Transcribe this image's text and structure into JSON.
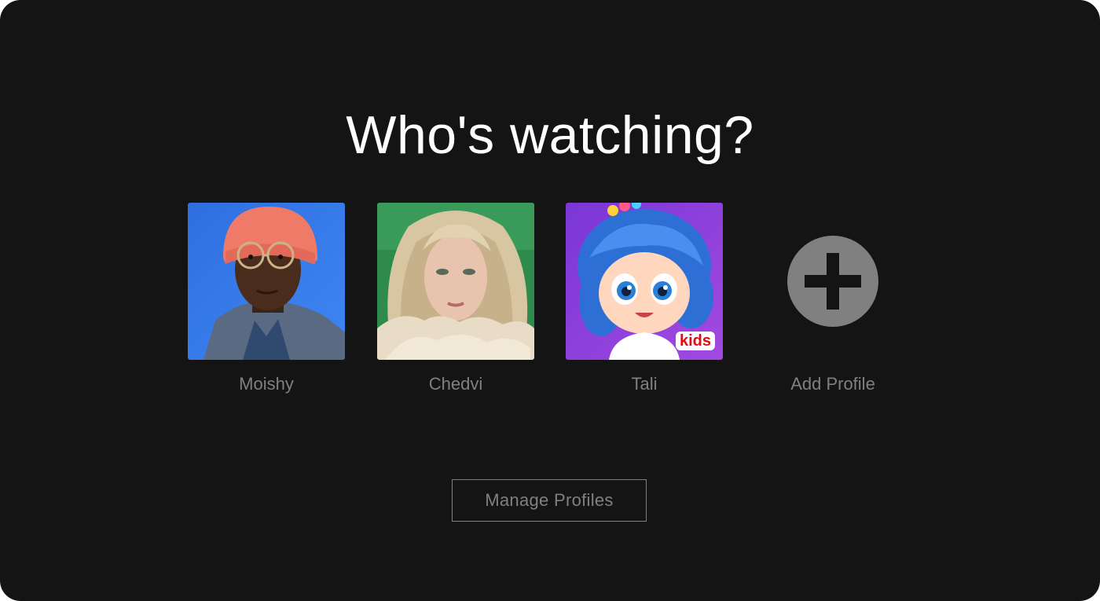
{
  "page": {
    "title": "Who's watching?",
    "background_color": "#141414"
  },
  "profiles": [
    {
      "name": "Moishy",
      "avatar": "man-orange-beanie-glasses-photo",
      "background_color": "#2f6fe0"
    },
    {
      "name": "Chedvi",
      "avatar": "woman-blonde-hair-fur-photo",
      "background_color": "#2f8a4e"
    },
    {
      "name": "Tali",
      "avatar": "cartoon-girl-blue-hair",
      "background_color": "#8a3fd8",
      "badge": "kids"
    }
  ],
  "add_profile": {
    "label": "Add Profile",
    "icon": "plus-icon",
    "color": "#808080"
  },
  "manage_button": {
    "label": "Manage Profiles"
  },
  "colors": {
    "text_primary": "#ffffff",
    "text_secondary": "#808080",
    "kids_badge": "#e50914"
  }
}
